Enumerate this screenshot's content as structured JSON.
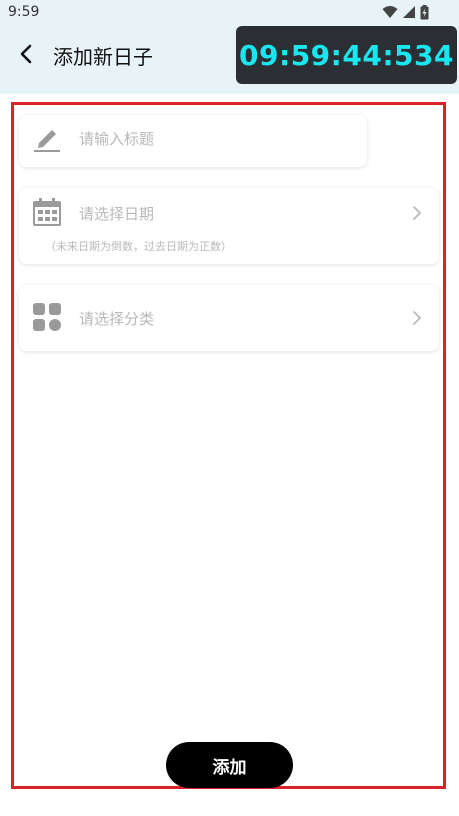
{
  "status_bar": {
    "time": "9:59"
  },
  "app_bar": {
    "title": "添加新日子",
    "back_icon": "chevron-left-icon"
  },
  "timer_overlay": {
    "text": "09:59:44:534"
  },
  "form": {
    "title_field": {
      "placeholder": "请输入标题",
      "icon": "pencil-icon"
    },
    "date_field": {
      "placeholder": "请选择日期",
      "hint": "（未来日期为倒数，过去日期为正数）",
      "icon": "calendar-icon"
    },
    "category_field": {
      "placeholder": "请选择分类",
      "icon": "category-grid-icon"
    }
  },
  "footer": {
    "add_button_label": "添加"
  },
  "colors": {
    "header_bg": "#e8f3f8",
    "timer_bg": "#2b2e33",
    "timer_text": "#19e6ef",
    "frame_border": "#d9222a",
    "placeholder": "#b9b9b9",
    "primary_button": "#000000"
  }
}
